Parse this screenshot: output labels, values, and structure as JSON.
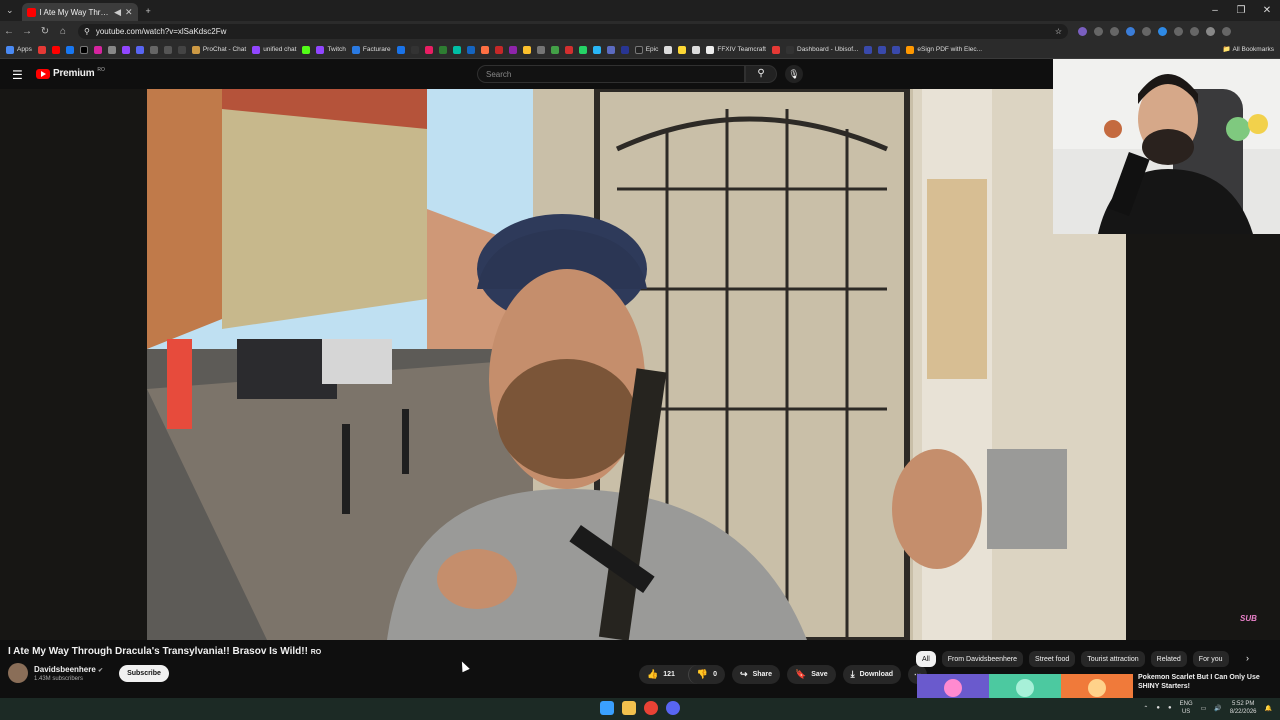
{
  "browser": {
    "tab_title": "I Ate My Way Through Dracula...",
    "url": "youtube.com/watch?v=xlSaKdsc2Fw",
    "bookmarks": [
      "Apps",
      "ProChat - Chat",
      "unified chat",
      "Twitch",
      "Facturare",
      "Epic",
      "FFXIV Teamcraft",
      "Dashboard - Ubisof...",
      "eSign PDF with Elec..."
    ],
    "all_bookmarks": "All Bookmarks"
  },
  "youtube": {
    "logo_text": "Premium",
    "logo_region": "RO",
    "search_placeholder": "Search"
  },
  "video": {
    "title": "I Ate My Way Through Dracula's Transylvania!! Brasov Is Wild!!",
    "title_suffix": "RO",
    "overlay_badge": "SUB"
  },
  "channel": {
    "name": "Davidsbeenhere",
    "subscribers": "1.43M subscribers",
    "subscribe_label": "Subscribe"
  },
  "actions": {
    "likes": "121",
    "dislikes": "0",
    "share": "Share",
    "save": "Save",
    "download": "Download",
    "more": "⋯"
  },
  "chips": [
    "All",
    "From Davidsbeenhere",
    "Street food",
    "Tourist attraction",
    "Related",
    "For you"
  ],
  "recommendation": {
    "title": "Pokemon Scarlet But I Can Only Use SHINY Starters!"
  },
  "taskbar": {
    "lang_top": "ENG",
    "lang_bottom": "US",
    "time": "5:52 PM",
    "date": "8/22/2026"
  },
  "colors": {
    "youtube_red": "#ff0000",
    "background": "#0f0f0f",
    "chip": "#272727"
  }
}
